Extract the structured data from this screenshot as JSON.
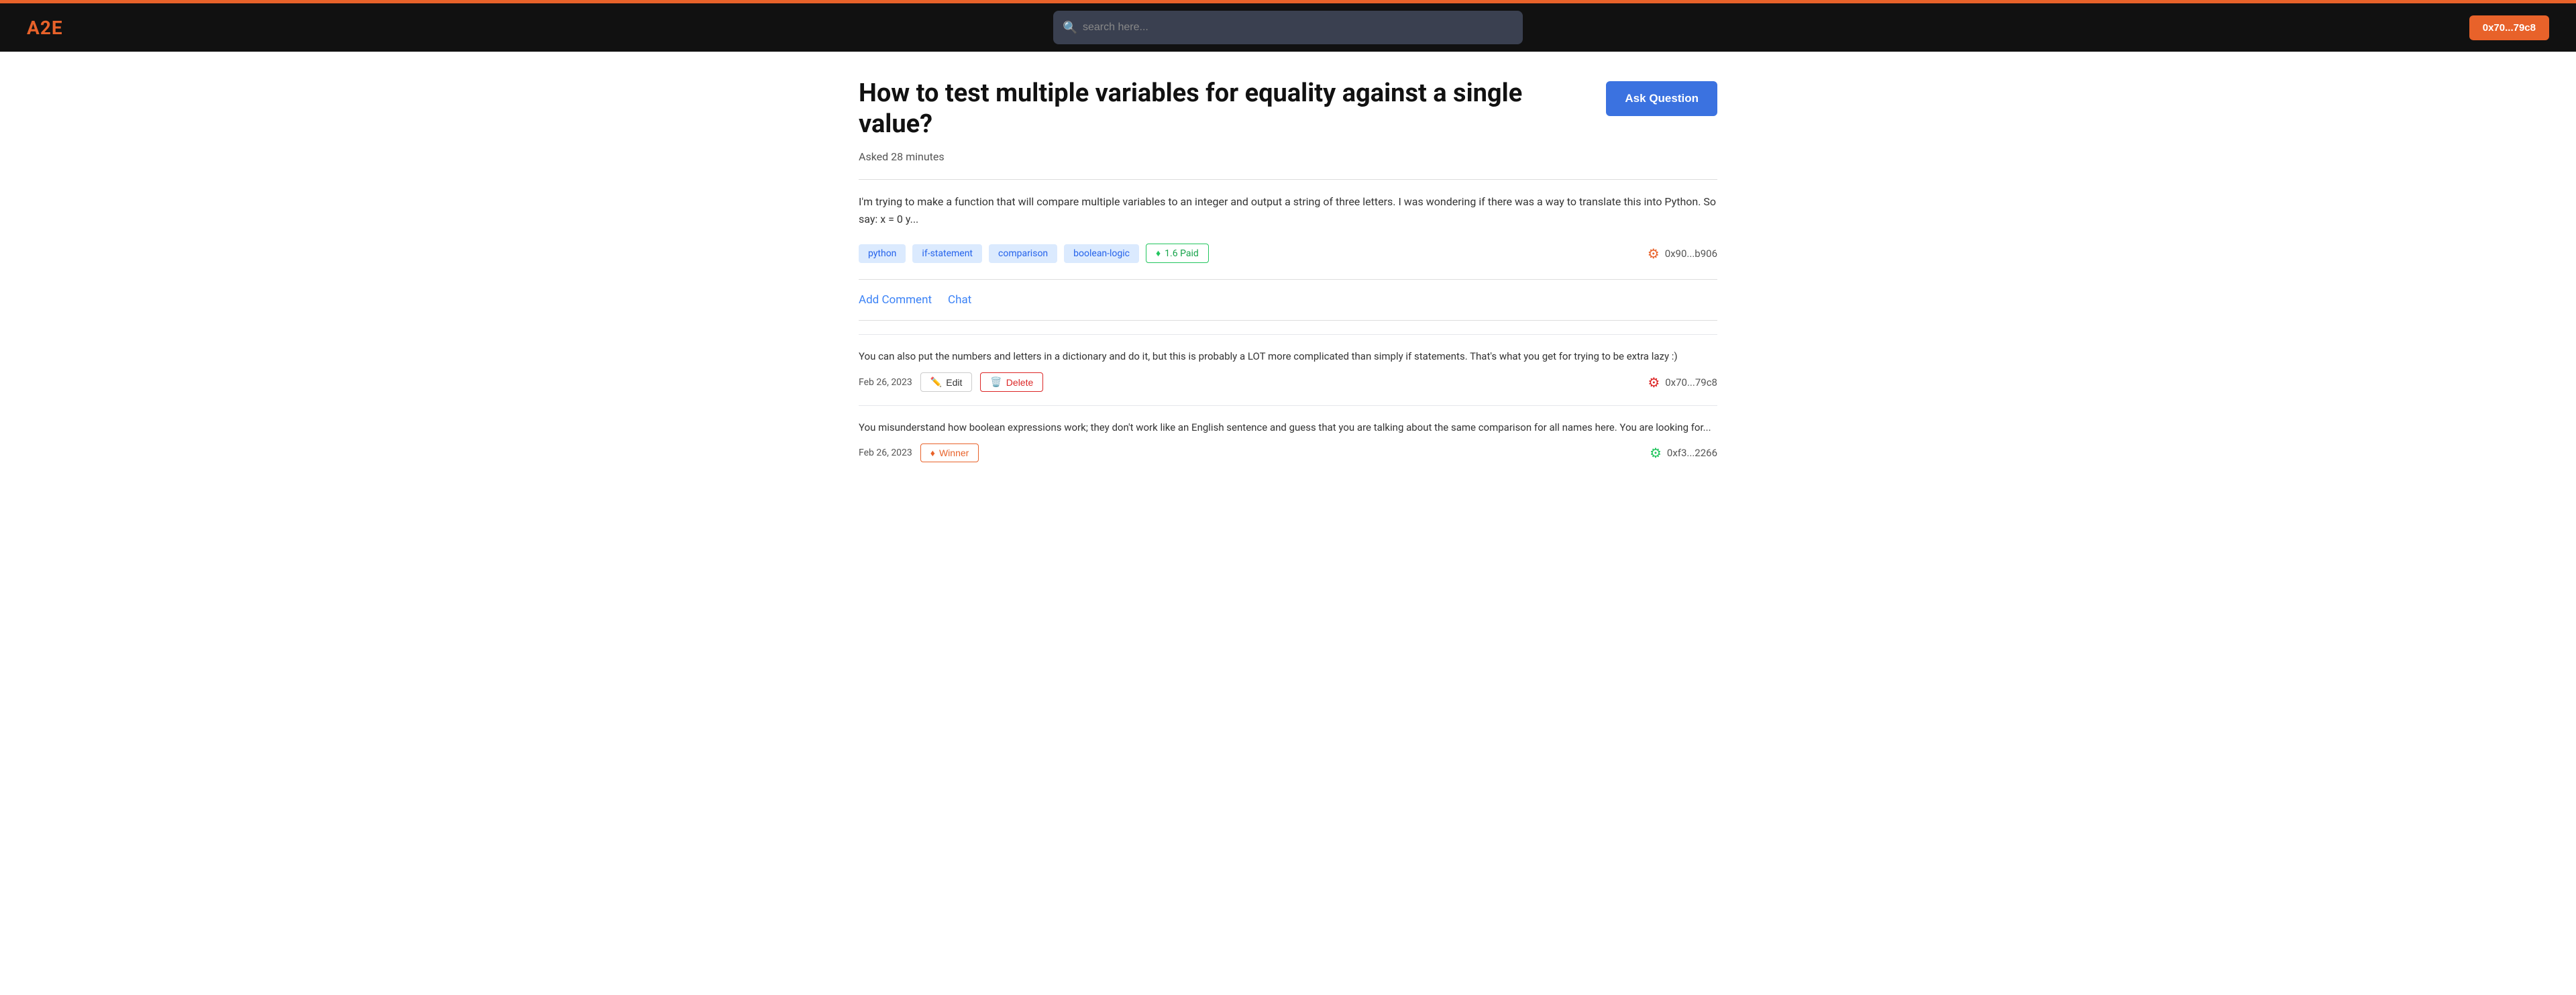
{
  "header": {
    "logo_prefix": "A",
    "logo_suffix": "2E",
    "search_placeholder": "search here...",
    "wallet_label": "0x70...79c8"
  },
  "page": {
    "title": "How to test multiple variables for equality against a single value?",
    "asked_time": "Asked 28 minutes",
    "ask_question_label": "Ask Question",
    "body": "I'm trying to make a function that will compare multiple variables to an integer and output a string of three letters. I was wondering if there was a way to translate this into Python. So say: x = 0 y...",
    "tags": [
      "python",
      "if-statement",
      "comparison",
      "boolean-logic"
    ],
    "paid_badge": "1.6 Paid",
    "question_user": "0x90...b906",
    "add_comment_label": "Add Comment",
    "chat_label": "Chat"
  },
  "comments": [
    {
      "text": "You can also put the numbers and letters in a dictionary and do it, but this is probably a LOT more complicated than simply if statements. That's what you get for trying to be extra lazy :)",
      "date": "Feb 26, 2023",
      "edit_label": "Edit",
      "delete_label": "Delete",
      "user": "0x70...79c8",
      "avatar_color": "red"
    },
    {
      "text": "You misunderstand how boolean expressions work; they don't work like an English sentence and guess that you are talking about the same comparison for all names here. You are looking for...",
      "date": "Feb 26, 2023",
      "winner_label": "Winner",
      "user": "0xf3...2266",
      "avatar_color": "green"
    }
  ],
  "icons": {
    "search": "🔍",
    "edit": "✏️",
    "delete": "🗑️",
    "winner": "♦",
    "paid": "♦",
    "avatar_red": "🏷",
    "avatar_orange": "🏷",
    "avatar_green": "🏷"
  }
}
